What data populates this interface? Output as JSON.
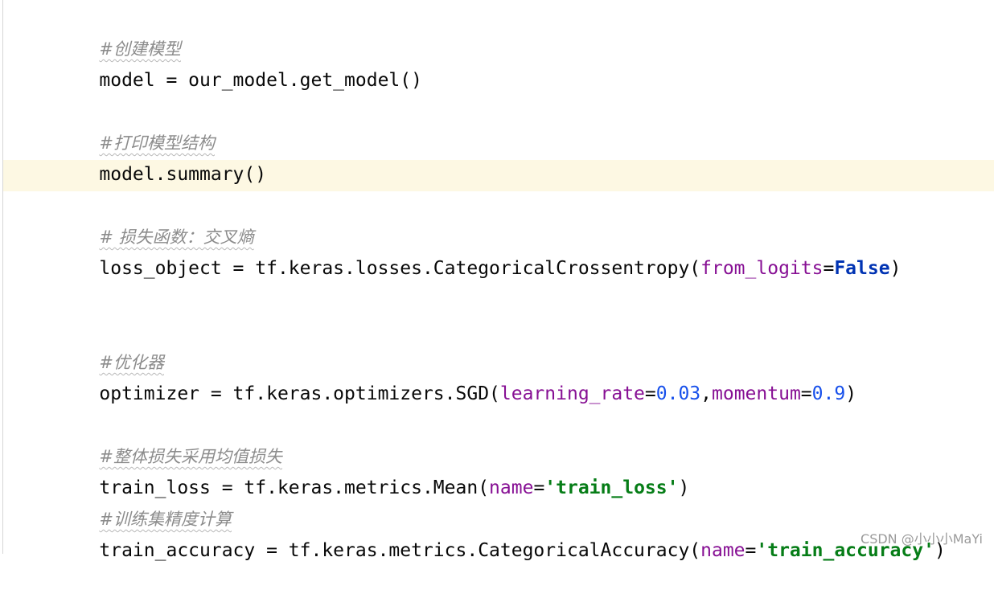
{
  "lines": {
    "c1": "#创建模型",
    "l1": "model = our_model.get_model()",
    "c2": "#打印模型结构",
    "l2": "model.summary()",
    "c3": "# 损失函数：交叉熵",
    "l3_a": "loss_object = tf.keras.losses.CategoricalCrossentropy(",
    "l3_param": "from_logits",
    "l3_eq": "=",
    "l3_kw": "False",
    "l3_end": ")",
    "c4": "#优化器",
    "l4_a": "optimizer = tf.keras.optimizers.SGD(",
    "l4_p1": "learning_rate",
    "l4_eq1": "=",
    "l4_n1": "0.03",
    "l4_comma": ",",
    "l4_p2": "momentum",
    "l4_eq2": "=",
    "l4_n2": "0.9",
    "l4_end": ")",
    "c5": "#整体损失采用均值损失",
    "l5_a": "train_loss = tf.keras.metrics.Mean(",
    "l5_param": "name",
    "l5_eq": "=",
    "l5_str": "'train_loss'",
    "l5_end": ")",
    "c6": "#训练集精度计算",
    "l6_a": "train_accuracy = tf.keras.metrics.CategoricalAccuracy(",
    "l6_param": "name",
    "l6_eq": "=",
    "l6_str": "'train_accuracy'",
    "l6_end": ")"
  },
  "watermark": "CSDN @小小小MaYi",
  "colors": {
    "comment": "#8c8c8c",
    "param": "#871094",
    "keyword": "#0033b3",
    "string": "#067d17",
    "number": "#1750eb",
    "current_line": "#fdf8e3"
  }
}
